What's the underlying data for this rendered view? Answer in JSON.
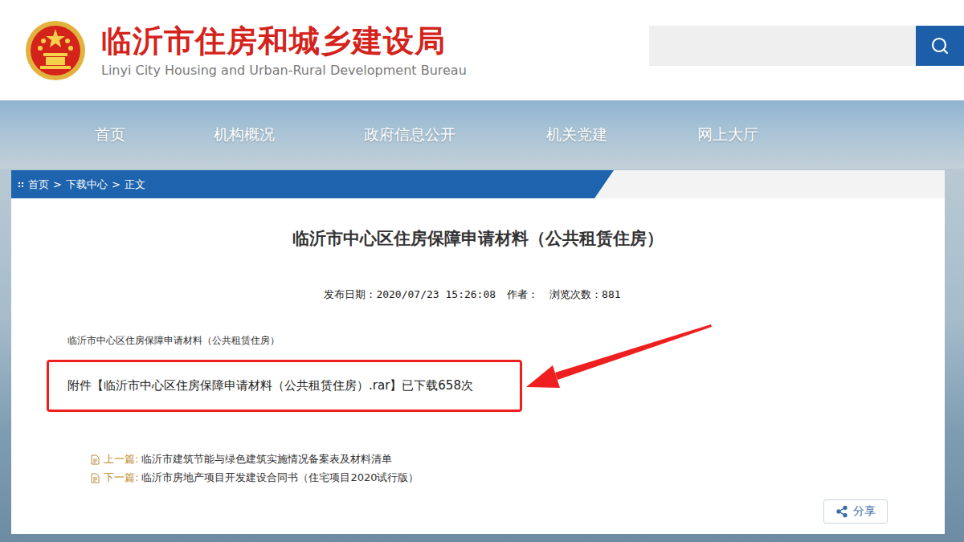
{
  "header": {
    "title": "临沂市住房和城乡建设局",
    "subtitle": "Linyi City Housing and Urban-Rural Development Bureau",
    "search": {
      "placeholder": ""
    }
  },
  "nav": [
    {
      "label": "首页"
    },
    {
      "label": "机构概况"
    },
    {
      "label": "政府信息公开"
    },
    {
      "label": "机关党建"
    },
    {
      "label": "网上大厅"
    }
  ],
  "breadcrumb": {
    "items": [
      "首页",
      "下载中心",
      "正文"
    ],
    "separator": ">"
  },
  "article": {
    "title": "临沂市中心区住房保障申请材料（公共租赁住房）",
    "meta": [
      "发布日期：2020/07/23 15:26:08",
      "作者：",
      "浏览次数：881"
    ],
    "body": "临沂市中心区住房保障申请材料（公共租赁住房）",
    "attachment": "附件【临沂市中心区住房保障申请材料（公共租赁住房）.rar】已下载658次"
  },
  "links": [
    {
      "label": "上一篇:",
      "title": "临沂市建筑节能与绿色建筑实施情况备案表及材料清单"
    },
    {
      "label": "下一篇:",
      "title": "临沂市房地产项目开发建设合同书（住宅项目2020试行版）"
    }
  ],
  "share": {
    "label": "分享"
  }
}
